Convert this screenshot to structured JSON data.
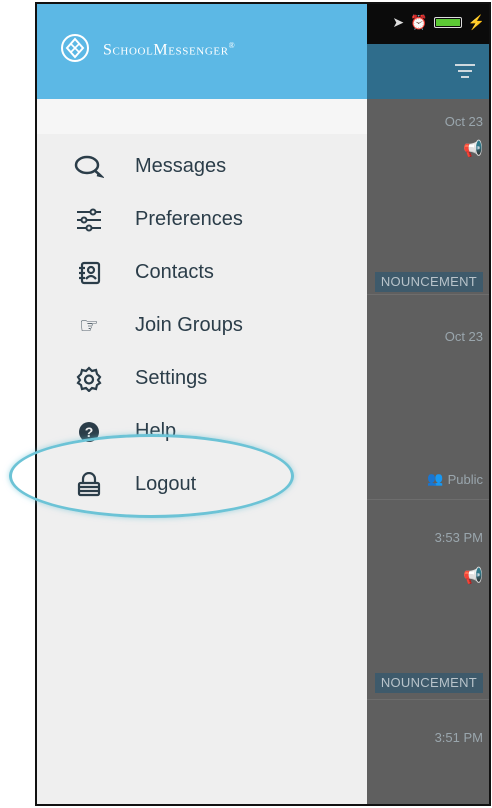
{
  "brand": {
    "name": "SchoolMessenger",
    "trademark": "®"
  },
  "menu": {
    "items": [
      {
        "label": "Messages",
        "icon": "messages-icon"
      },
      {
        "label": "Preferences",
        "icon": "sliders-icon"
      },
      {
        "label": "Contacts",
        "icon": "address-book-icon"
      },
      {
        "label": "Join Groups",
        "icon": "pointing-hand-icon"
      },
      {
        "label": "Settings",
        "icon": "gear-icon"
      },
      {
        "label": "Help",
        "icon": "help-icon"
      },
      {
        "label": "Logout",
        "icon": "lock-icon"
      }
    ],
    "highlighted": "Logout"
  },
  "background_list": {
    "items": [
      {
        "time": "Oct 23",
        "megaphone": true,
        "badge": "NOUNCEMENT"
      },
      {
        "time": "Oct 23",
        "public": "Public"
      },
      {
        "time": "3:53 PM",
        "megaphone": true,
        "badge": "NOUNCEMENT"
      },
      {
        "time": "3:51 PM"
      }
    ]
  },
  "colors": {
    "drawer_header": "#5cb8e5",
    "app_header": "#2f6d8c",
    "highlight": "#6cc3d6",
    "menu_text": "#2b3d49",
    "alert_red": "#b0262b"
  }
}
